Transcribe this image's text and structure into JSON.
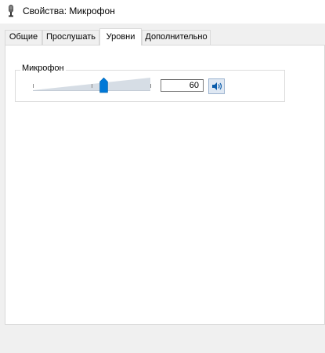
{
  "window": {
    "title": "Свойства: Микрофон",
    "title_icon": "microphone-icon"
  },
  "tabs": [
    {
      "label": "Общие",
      "active": false
    },
    {
      "label": "Прослушать",
      "active": false
    },
    {
      "label": "Уровни",
      "active": true
    },
    {
      "label": "Дополнительно",
      "active": false
    }
  ],
  "levels": {
    "group_label": "Микрофон",
    "slider_value": 60,
    "slider_max": 100,
    "value_text": "60",
    "speaker_icon": "speaker-icon"
  },
  "colors": {
    "accent": "#0078d7",
    "track": "#d6dde5"
  }
}
